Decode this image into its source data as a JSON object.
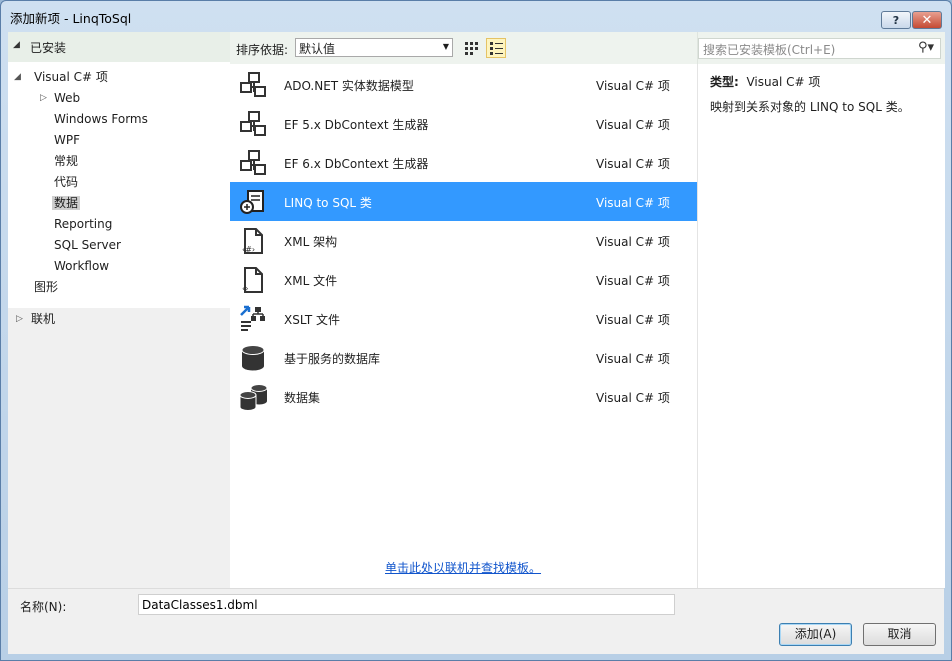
{
  "window": {
    "title": "添加新项 - LinqToSql",
    "help_label": "?",
    "close_label": "✕"
  },
  "left": {
    "installed_label": "已安装",
    "tree": [
      {
        "label": "Visual C# 项",
        "expander": "◢"
      },
      {
        "label": "Web",
        "expander": "▷"
      },
      {
        "label": "Windows Forms"
      },
      {
        "label": "WPF"
      },
      {
        "label": "常规"
      },
      {
        "label": "代码"
      },
      {
        "label": "数据"
      },
      {
        "label": "Reporting"
      },
      {
        "label": "SQL Server"
      },
      {
        "label": "Workflow"
      },
      {
        "label": "图形"
      }
    ],
    "online_label": "联机"
  },
  "sort": {
    "label": "排序依据:",
    "value": "默认值"
  },
  "search": {
    "placeholder": "搜索已安装模板(Ctrl+E)"
  },
  "items": [
    {
      "name": "ADO.NET 实体数据模型",
      "type": "Visual C# 项",
      "icon": "entity-model-icon"
    },
    {
      "name": "EF 5.x DbContext 生成器",
      "type": "Visual C# 项",
      "icon": "dbcontext-icon"
    },
    {
      "name": "EF 6.x DbContext 生成器",
      "type": "Visual C# 项",
      "icon": "dbcontext-icon"
    },
    {
      "name": "LINQ to SQL 类",
      "type": "Visual C# 项",
      "icon": "linq-sql-icon",
      "selected": true
    },
    {
      "name": "XML 架构",
      "type": "Visual C# 项",
      "icon": "xml-schema-icon"
    },
    {
      "name": "XML 文件",
      "type": "Visual C# 项",
      "icon": "xml-file-icon"
    },
    {
      "name": "XSLT 文件",
      "type": "Visual C# 项",
      "icon": "xslt-icon"
    },
    {
      "name": "基于服务的数据库",
      "type": "Visual C# 项",
      "icon": "database-icon"
    },
    {
      "name": "数据集",
      "type": "Visual C# 项",
      "icon": "dataset-icon"
    }
  ],
  "online_link": "单击此处以联机并查找模板。",
  "details": {
    "type_label": "类型:",
    "type_value": "Visual C# 项",
    "description": "映射到关系对象的 LINQ to SQL 类。"
  },
  "name_field": {
    "label": "名称(N):",
    "value": "DataClasses1.dbml"
  },
  "buttons": {
    "add": "添加(A)",
    "cancel": "取消"
  },
  "colors": {
    "selection": "#3399ff",
    "link": "#1155cc"
  }
}
